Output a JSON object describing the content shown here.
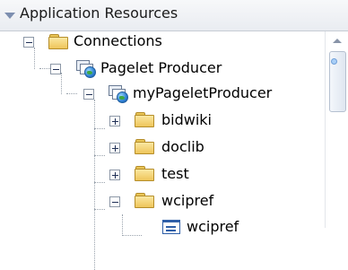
{
  "panel": {
    "title": "Application Resources"
  },
  "tree": {
    "connections": {
      "label": "Connections"
    },
    "pagelet_producer": {
      "label": "Pagelet Producer"
    },
    "my_pagelet_producer": {
      "label": "myPageletProducer"
    },
    "children": [
      {
        "label": "bidwiki"
      },
      {
        "label": "doclib"
      },
      {
        "label": "test"
      },
      {
        "label": "wcipref"
      }
    ],
    "leaf": {
      "label": "wcipref"
    }
  },
  "colors": {
    "folder": "#eec55a",
    "link": "#2f5fa8",
    "header_bg": "#e9ecf1"
  },
  "icons": [
    "expand-triangle-icon",
    "folder-icon",
    "pagelet-producer-icon",
    "pagelet-icon"
  ]
}
